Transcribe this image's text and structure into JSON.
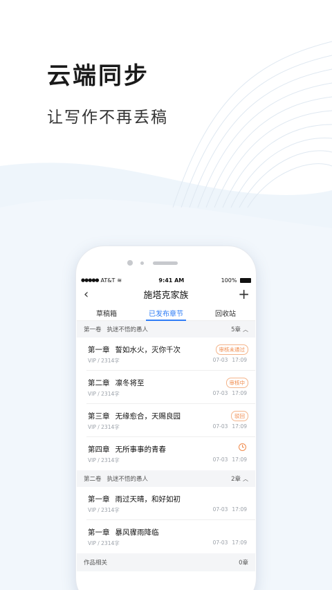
{
  "hero": {
    "title": "云端同步",
    "subtitle": "让写作不再丢稿"
  },
  "colors": {
    "accent": "#2f7df6",
    "status_orange": "#f08a4b",
    "section_bg": "#f4f5f7"
  },
  "status_bar": {
    "carrier": "AT&T",
    "time": "9:41 AM",
    "battery": "100%"
  },
  "nav": {
    "title": "施塔克家族",
    "back_icon": "chevron-left-icon",
    "add_icon": "plus-icon"
  },
  "tabs": [
    {
      "label": "草稿箱"
    },
    {
      "label": "已发布章节",
      "active": true
    },
    {
      "label": "回收站"
    }
  ],
  "volumes": [
    {
      "label": "第一卷",
      "name": "执迷不悟的愚人",
      "count": "5章",
      "chapters": [
        {
          "num": "第一章",
          "title": "誓如水火，灭你千次",
          "meta": "VIP / 2314字",
          "date": "07-03",
          "time": "17:09",
          "status": "审核未通过"
        },
        {
          "num": "第二章",
          "title": "凛冬将至",
          "meta": "VIP / 2314字",
          "date": "07-03",
          "time": "17:09",
          "status": "审核中"
        },
        {
          "num": "第三章",
          "title": "无缘愈合，天赐良园",
          "meta": "VIP / 2314字",
          "date": "07-03",
          "time": "17:09",
          "status": "驳回"
        },
        {
          "num": "第四章",
          "title": "无所事事的青春",
          "meta": "VIP / 2314字",
          "date": "07-03",
          "time": "17:09",
          "status": ""
        }
      ]
    },
    {
      "label": "第二卷",
      "name": "执迷不悟的愚人",
      "count": "2章",
      "chapters": [
        {
          "num": "第一章",
          "title": "雨过天晴，和好如初",
          "meta": "VIP / 2314字",
          "date": "07-03",
          "time": "17:09"
        },
        {
          "num": "第一章",
          "title": "暴风骤雨降临",
          "meta": "VIP / 2314字",
          "date": "07-03",
          "time": "17:09"
        }
      ]
    }
  ],
  "works": {
    "label": "作品相关",
    "count": "0章"
  }
}
